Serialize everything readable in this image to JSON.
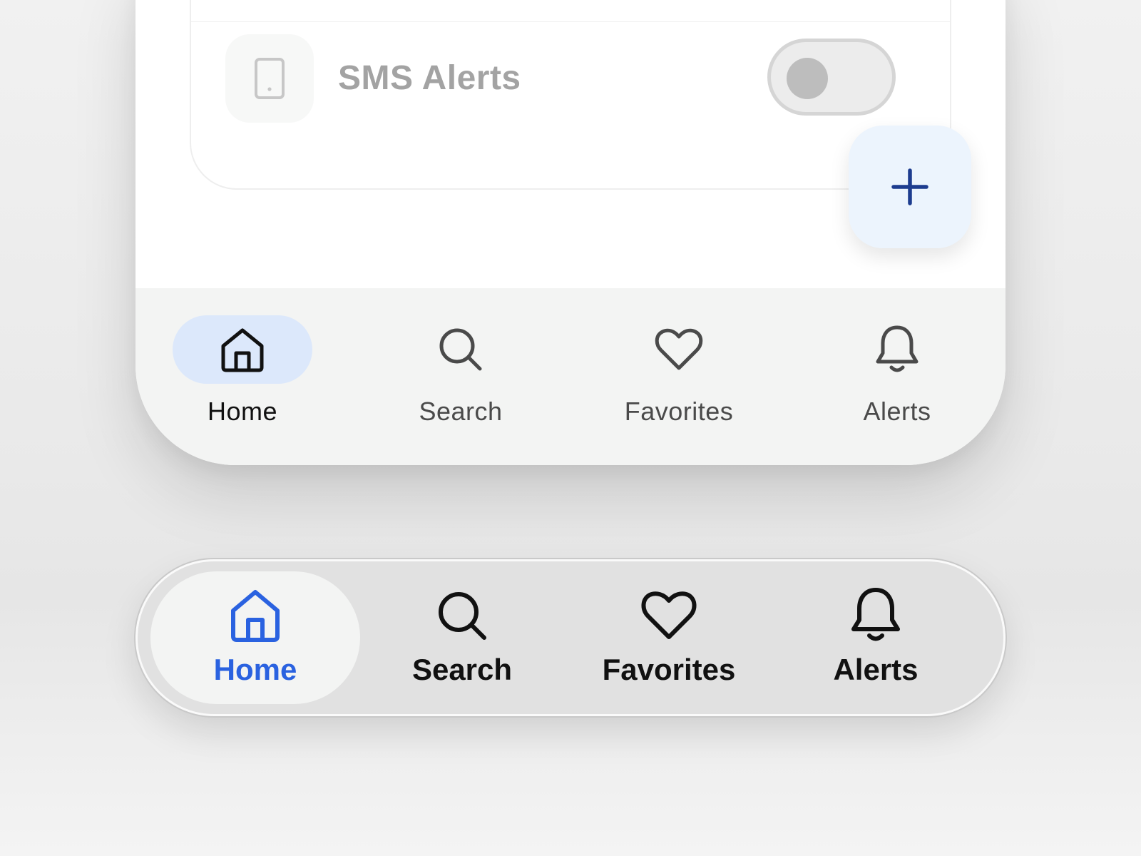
{
  "settings": {
    "sms_alerts_label": "SMS Alerts",
    "sms_alerts_enabled": false,
    "sms_icon": "phone-icon"
  },
  "fab": {
    "icon": "plus-icon"
  },
  "nav_primary": {
    "active_background": "#dce8fb",
    "items": [
      {
        "label": "Home",
        "icon": "home-icon",
        "active": true
      },
      {
        "label": "Search",
        "icon": "search-icon",
        "active": false
      },
      {
        "label": "Favorites",
        "icon": "heart-icon",
        "active": false
      },
      {
        "label": "Alerts",
        "icon": "bell-icon",
        "active": false
      }
    ]
  },
  "nav_pill": {
    "accent": "#2a62e0",
    "items": [
      {
        "label": "Home",
        "icon": "home-icon",
        "active": true
      },
      {
        "label": "Search",
        "icon": "search-icon",
        "active": false
      },
      {
        "label": "Favorites",
        "icon": "heart-icon",
        "active": false
      },
      {
        "label": "Alerts",
        "icon": "bell-icon",
        "active": false
      }
    ]
  }
}
